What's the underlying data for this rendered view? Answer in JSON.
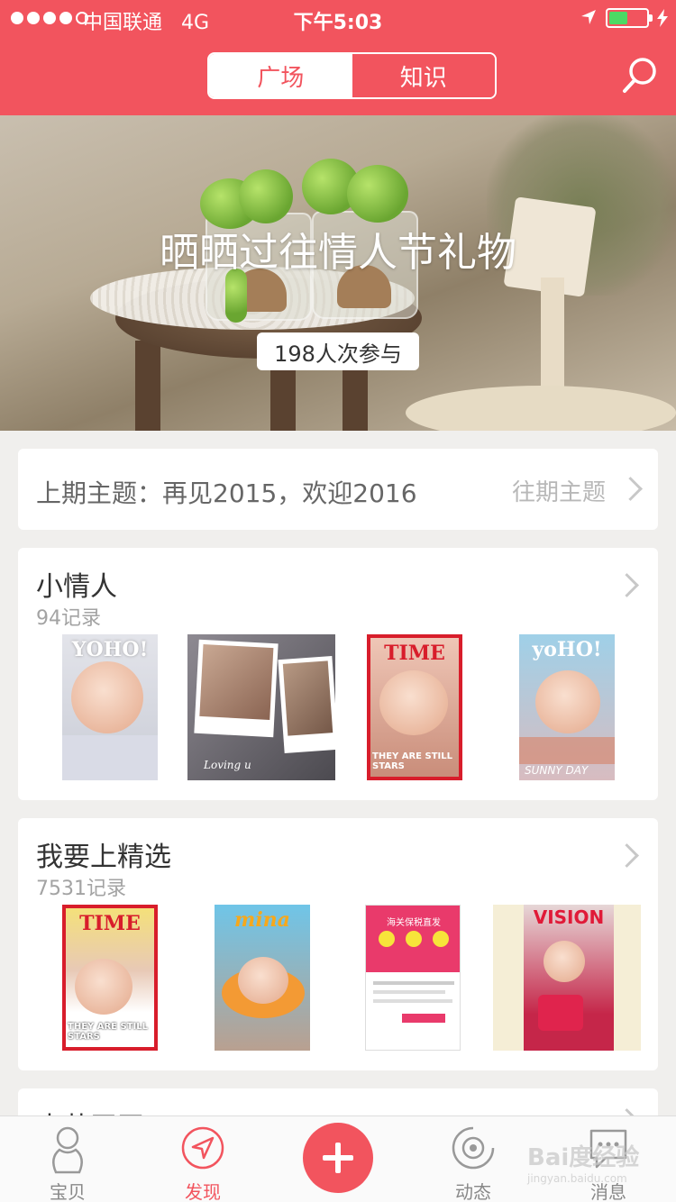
{
  "status": {
    "carrier": "中国联通",
    "network": "4G",
    "time": "下午5:03",
    "battery_level": 0.5
  },
  "header": {
    "tabs": [
      {
        "label": "广场",
        "active": true
      },
      {
        "label": "知识",
        "active": false
      }
    ],
    "search_icon": "search-icon",
    "accent": "#f2545e"
  },
  "banner": {
    "title": "晒晒过往情人节礼物",
    "participants": "198人次参与"
  },
  "prev_topic": {
    "label": "上期主题：再见2015，欢迎2016",
    "more": "往期主题"
  },
  "groups": [
    {
      "title": "小情人",
      "count": "94记录",
      "thumbs": [
        {
          "title": "YOHO!"
        },
        {
          "caption": "Loving u"
        },
        {
          "title": "TIME",
          "sub": "THEY ARE STILL STARS"
        },
        {
          "title": "yoHO!",
          "caption": "SUNNY DAY"
        }
      ]
    },
    {
      "title": "我要上精选",
      "count": "7531记录",
      "thumbs": [
        {
          "title": "TIME",
          "sub": "THEY ARE STILL STARS"
        },
        {
          "title": "mina"
        },
        {
          "title": "海关保税直发"
        },
        {
          "title": "VISION"
        }
      ]
    },
    {
      "title": "吉萌王田"
    }
  ],
  "tabbar": [
    {
      "label": "宝贝",
      "icon": "baby-icon",
      "active": false
    },
    {
      "label": "发现",
      "icon": "compass-icon",
      "active": true
    },
    {
      "label": "",
      "icon": "plus-icon",
      "active": false
    },
    {
      "label": "动态",
      "icon": "activity-icon",
      "active": false
    },
    {
      "label": "消息",
      "icon": "message-icon",
      "active": false
    }
  ],
  "watermark": {
    "main": "Bai度经验",
    "sub": "jingyan.baidu.com"
  }
}
